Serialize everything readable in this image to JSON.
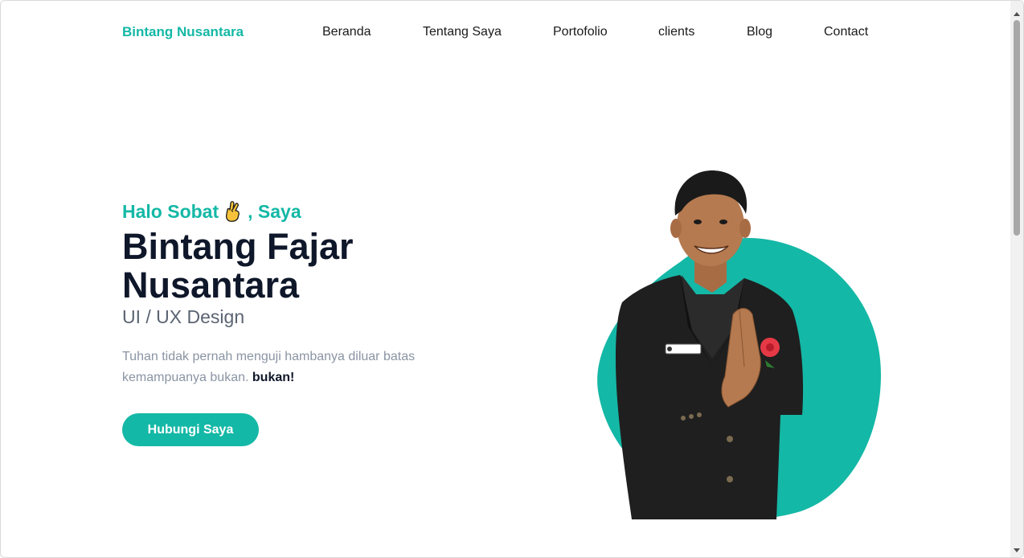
{
  "navbar": {
    "brand": "Bintang Nusantara",
    "links": [
      "Beranda",
      "Tentang Saya",
      "Portofolio",
      "clients",
      "Blog",
      "Contact"
    ]
  },
  "hero": {
    "greeting_before": "Halo Sobat",
    "greeting_after": ", Saya",
    "greeting_icon": "crossed-fingers-icon",
    "name": "Bintang Fajar Nusantara",
    "role": "UI / UX Design",
    "quote": "Tuhan tidak pernah menguji hambanya diluar batas kemampuanya bukan.",
    "quote_emphasis": "bukan!",
    "cta_label": "Hubungi Saya",
    "photo_icon": "portrait-photo"
  },
  "colors": {
    "accent": "#14b8a6",
    "heading": "#0f172a",
    "muted": "#8a94a3",
    "suit": "#1f1f1f"
  }
}
